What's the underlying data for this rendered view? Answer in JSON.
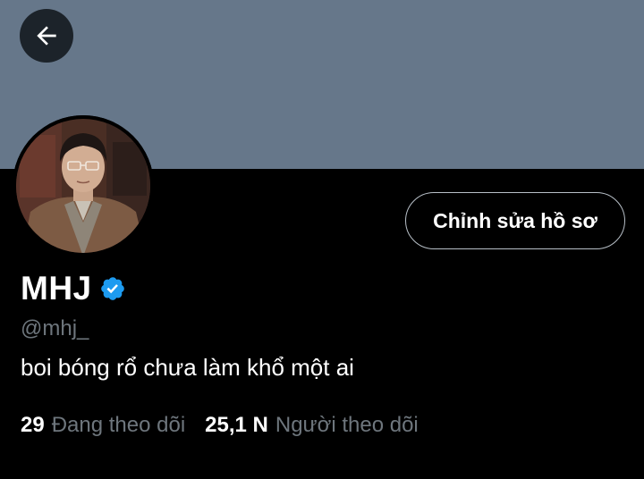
{
  "profile": {
    "display_name": "MHJ",
    "handle": "@mhj_",
    "bio": "boi bóng rổ chưa làm khổ một ai",
    "edit_label": "Chỉnh sửa hồ sơ",
    "verified": true
  },
  "stats": {
    "following_count": "29",
    "following_label": "Đang theo dõi",
    "followers_count": "25,1 N",
    "followers_label": "Người theo dõi"
  },
  "icons": {
    "back": "arrow-left-icon",
    "verified": "verified-badge-icon"
  },
  "colors": {
    "banner": "#66778a",
    "background": "#000000",
    "verified": "#1d9bf0",
    "secondary_text": "#6e767d"
  }
}
